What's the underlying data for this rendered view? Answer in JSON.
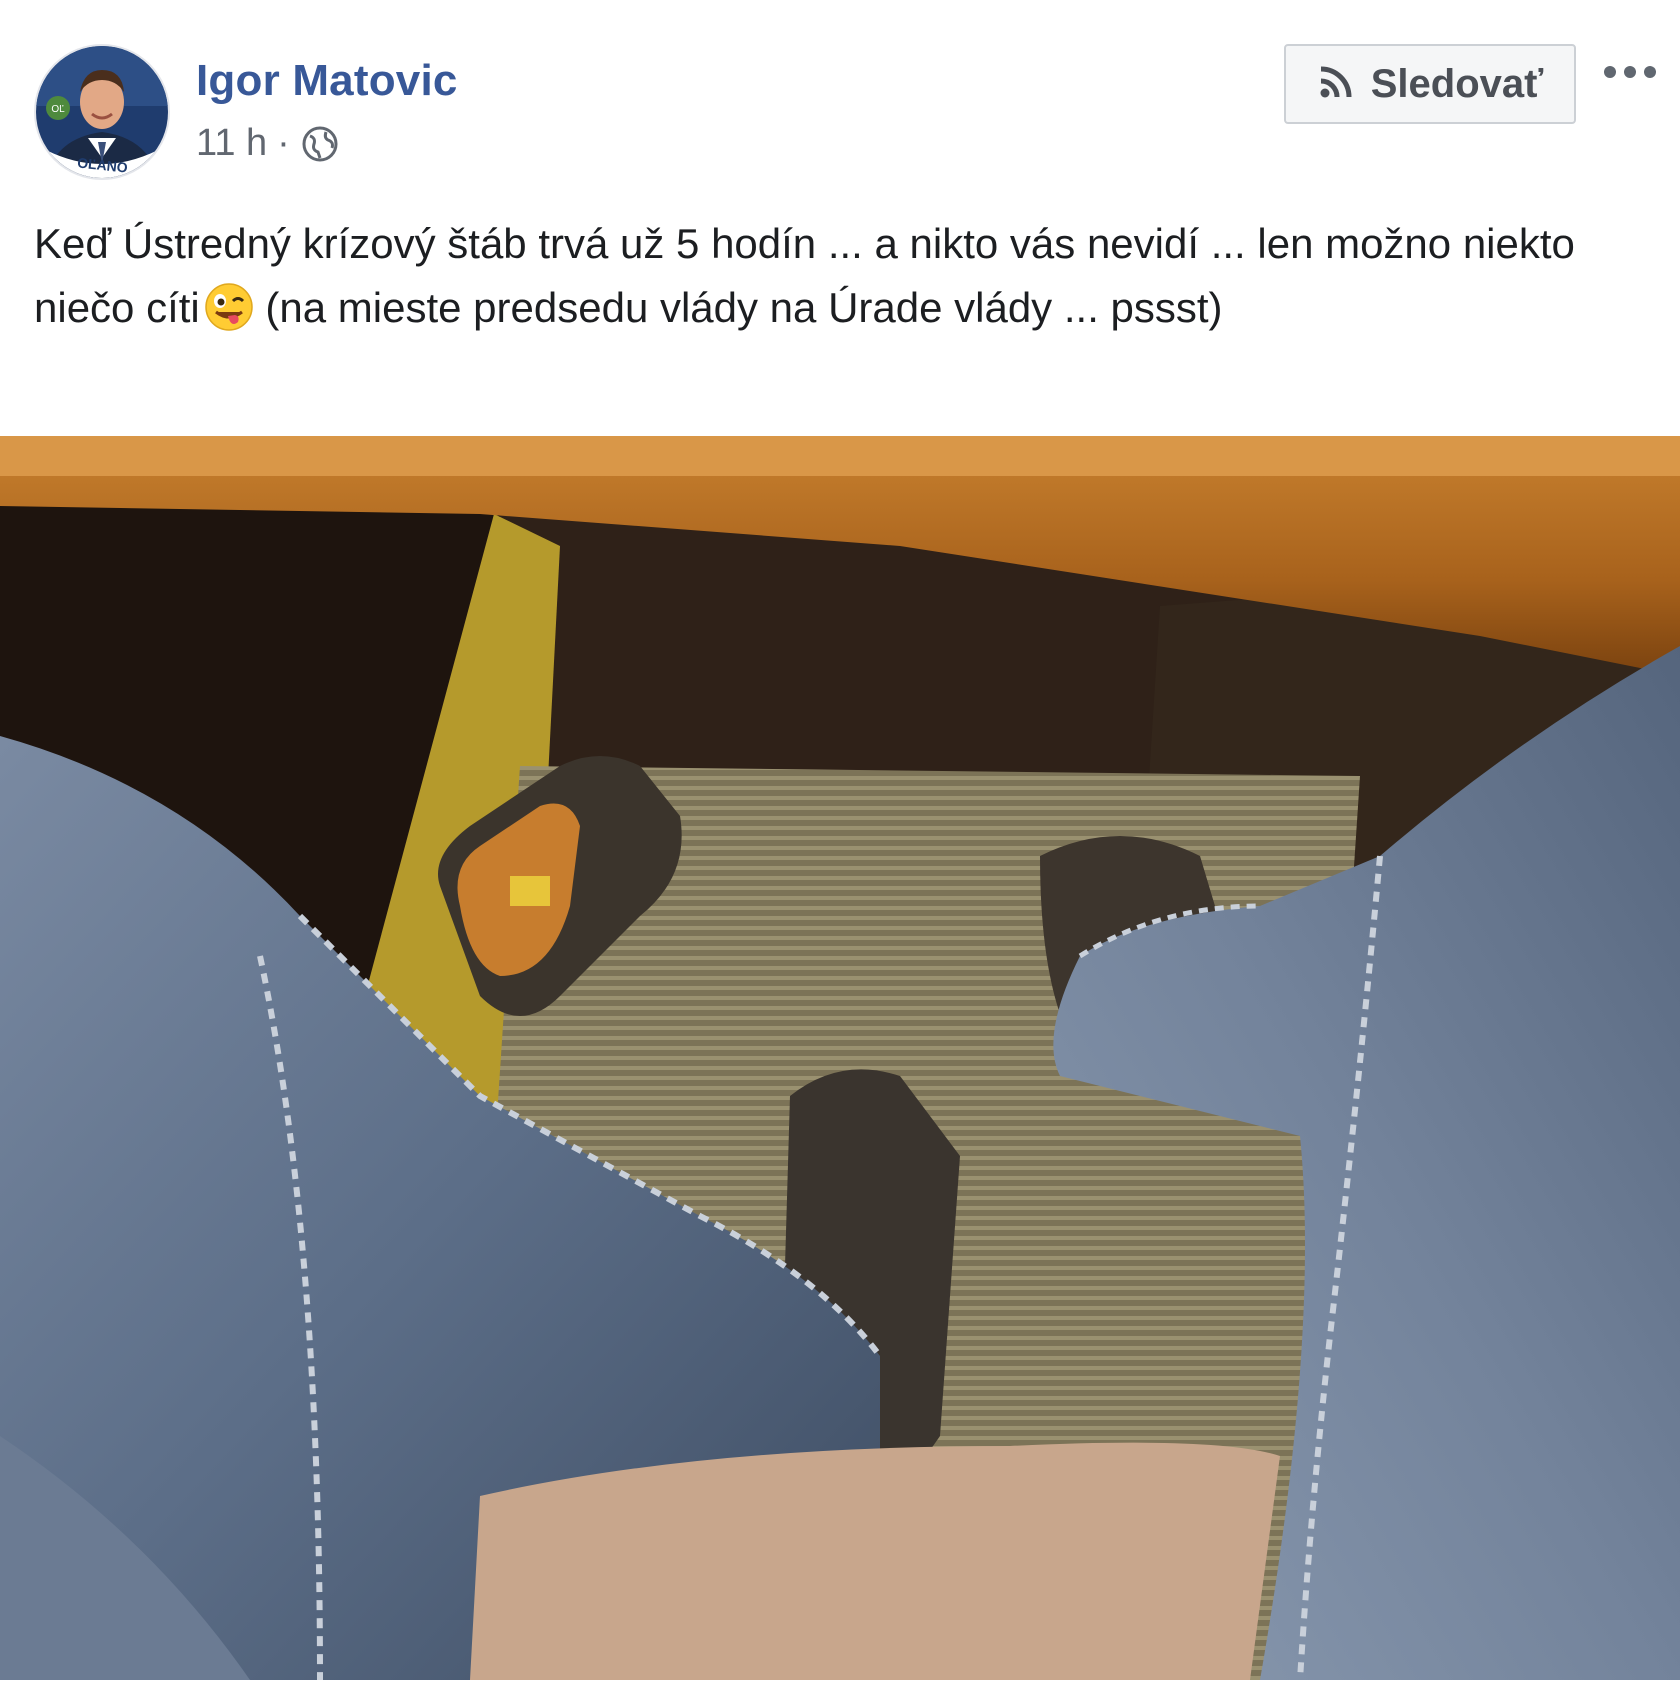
{
  "post": {
    "author": "Igor Matovic",
    "time": "11 h",
    "separator": "·",
    "follow_label": "Sledovať",
    "text_before_emoji": "Keď Ústredný krízový štáb trvá už 5 hodín ... a nikto vás nevidí ... len možno niekto niečo cíti",
    "text_after_emoji": " (na mieste predsedu vlády na Úrade vlády ... pssst)",
    "avatar_badge": "OĽANO"
  },
  "icons": {
    "audience": "globe-icon",
    "follow": "rss-icon",
    "more": "more-options-icon",
    "emoji": "winking-face-with-tongue"
  },
  "colors": {
    "author_link": "#385898",
    "meta_text": "#616770",
    "body_text": "#1c1e21",
    "button_bg": "#f5f6f7",
    "button_border": "#ccd0d5"
  }
}
